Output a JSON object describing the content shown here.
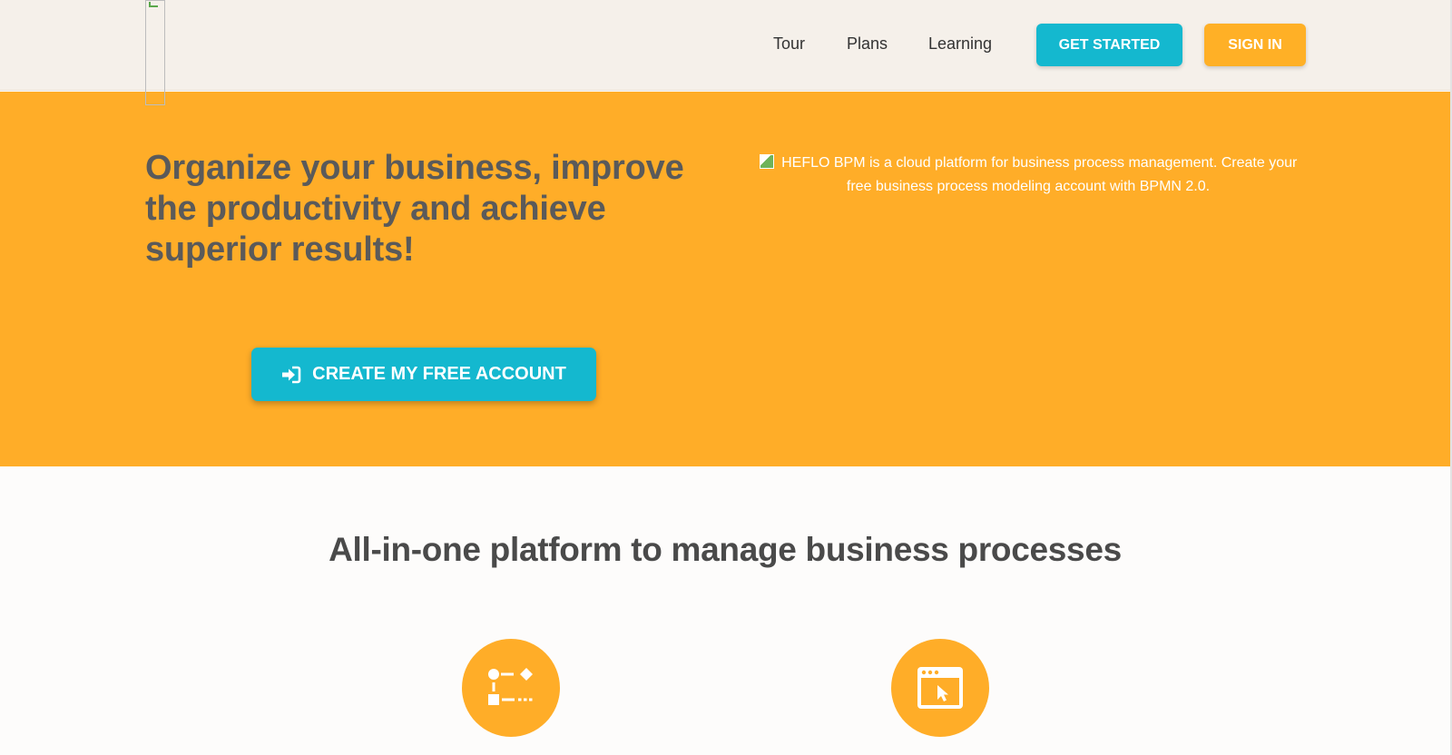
{
  "header": {
    "nav": {
      "tour": "Tour",
      "plans": "Plans",
      "learning": "Learning"
    },
    "get_started_label": "GET STARTED",
    "sign_in_label": "SIGN IN"
  },
  "hero": {
    "title": "Organize your business, improve the productivity and achieve superior results!",
    "image_alt": "HEFLO BPM is a cloud platform for business process management. Create your free business process modeling account with BPMN 2.0.",
    "cta_label": "CREATE MY FREE ACCOUNT",
    "cta_icon": "sign-in-icon"
  },
  "features": {
    "title": "All-in-one platform to manage business processes",
    "icons": [
      "process-flow-icon",
      "browser-window-cursor-icon"
    ]
  },
  "colors": {
    "header_bg": "#f5f0ea",
    "hero_bg": "#ffad28",
    "accent_teal": "#14b8cf",
    "accent_orange": "#ffb026",
    "heading_text": "#5a5a5a"
  }
}
